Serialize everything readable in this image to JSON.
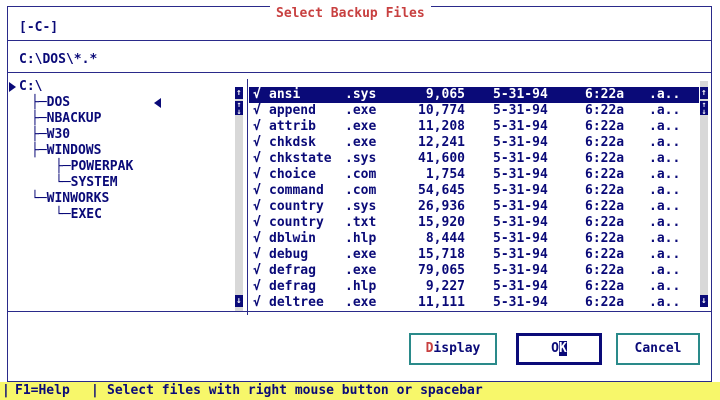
{
  "dialog": {
    "title": "Select Backup Files",
    "drive": "[-C-]",
    "path": "C:\\DOS\\*.*"
  },
  "tree": [
    {
      "text": "C:\\",
      "prefix": "",
      "indent": 0
    },
    {
      "text": "DOS",
      "prefix": "├─",
      "indent": 1
    },
    {
      "text": "NBACKUP",
      "prefix": "├─",
      "indent": 1
    },
    {
      "text": "W30",
      "prefix": "├─",
      "indent": 1
    },
    {
      "text": "WINDOWS",
      "prefix": "├─",
      "indent": 1
    },
    {
      "text": "POWERPAK",
      "prefix": "├─",
      "indent": 2
    },
    {
      "text": "SYSTEM",
      "prefix": "└─",
      "indent": 2
    },
    {
      "text": "WINWORKS",
      "prefix": "└─",
      "indent": 1
    },
    {
      "text": "EXEC",
      "prefix": "└─",
      "indent": 2
    }
  ],
  "files": [
    {
      "check": "√",
      "name": "ansi",
      "ext": ".sys",
      "size": "9,065",
      "date": "5-31-94",
      "time": "6:22a",
      "attr": ".a.."
    },
    {
      "check": "√",
      "name": "append",
      "ext": ".exe",
      "size": "10,774",
      "date": "5-31-94",
      "time": "6:22a",
      "attr": ".a.."
    },
    {
      "check": "√",
      "name": "attrib",
      "ext": ".exe",
      "size": "11,208",
      "date": "5-31-94",
      "time": "6:22a",
      "attr": ".a.."
    },
    {
      "check": "√",
      "name": "chkdsk",
      "ext": ".exe",
      "size": "12,241",
      "date": "5-31-94",
      "time": "6:22a",
      "attr": ".a.."
    },
    {
      "check": "√",
      "name": "chkstate",
      "ext": ".sys",
      "size": "41,600",
      "date": "5-31-94",
      "time": "6:22a",
      "attr": ".a.."
    },
    {
      "check": "√",
      "name": "choice",
      "ext": ".com",
      "size": "1,754",
      "date": "5-31-94",
      "time": "6:22a",
      "attr": ".a.."
    },
    {
      "check": "√",
      "name": "command",
      "ext": ".com",
      "size": "54,645",
      "date": "5-31-94",
      "time": "6:22a",
      "attr": ".a.."
    },
    {
      "check": "√",
      "name": "country",
      "ext": ".sys",
      "size": "26,936",
      "date": "5-31-94",
      "time": "6:22a",
      "attr": ".a.."
    },
    {
      "check": "√",
      "name": "country",
      "ext": ".txt",
      "size": "15,920",
      "date": "5-31-94",
      "time": "6:22a",
      "attr": ".a.."
    },
    {
      "check": "√",
      "name": "dblwin",
      "ext": ".hlp",
      "size": "8,444",
      "date": "5-31-94",
      "time": "6:22a",
      "attr": ".a.."
    },
    {
      "check": "√",
      "name": "debug",
      "ext": ".exe",
      "size": "15,718",
      "date": "5-31-94",
      "time": "6:22a",
      "attr": ".a.."
    },
    {
      "check": "√",
      "name": "defrag",
      "ext": ".exe",
      "size": "79,065",
      "date": "5-31-94",
      "time": "6:22a",
      "attr": ".a.."
    },
    {
      "check": "√",
      "name": "defrag",
      "ext": ".hlp",
      "size": "9,227",
      "date": "5-31-94",
      "time": "6:22a",
      "attr": ".a.."
    },
    {
      "check": "√",
      "name": "deltree",
      "ext": ".exe",
      "size": "11,111",
      "date": "5-31-94",
      "time": "6:22a",
      "attr": ".a.."
    }
  ],
  "buttons": {
    "display_hot": "D",
    "display_rest": "isplay",
    "ok_first": "O",
    "ok_cursor": "K",
    "cancel": "Cancel"
  },
  "status": {
    "help": "F1=Help",
    "message": "Select files with right mouse button or spacebar"
  },
  "icons": {
    "scroll_up": "up-arrow-icon",
    "scroll_down": "down-arrow-icon",
    "current_dir": "left-triangle-icon",
    "tree_marker": "right-triangle-icon"
  },
  "colors": {
    "text": "#0a0a78",
    "title": "#c84040",
    "selection": "#0a0a78",
    "button_border": "#2a8a8a",
    "status_bg": "#f7f76a"
  }
}
